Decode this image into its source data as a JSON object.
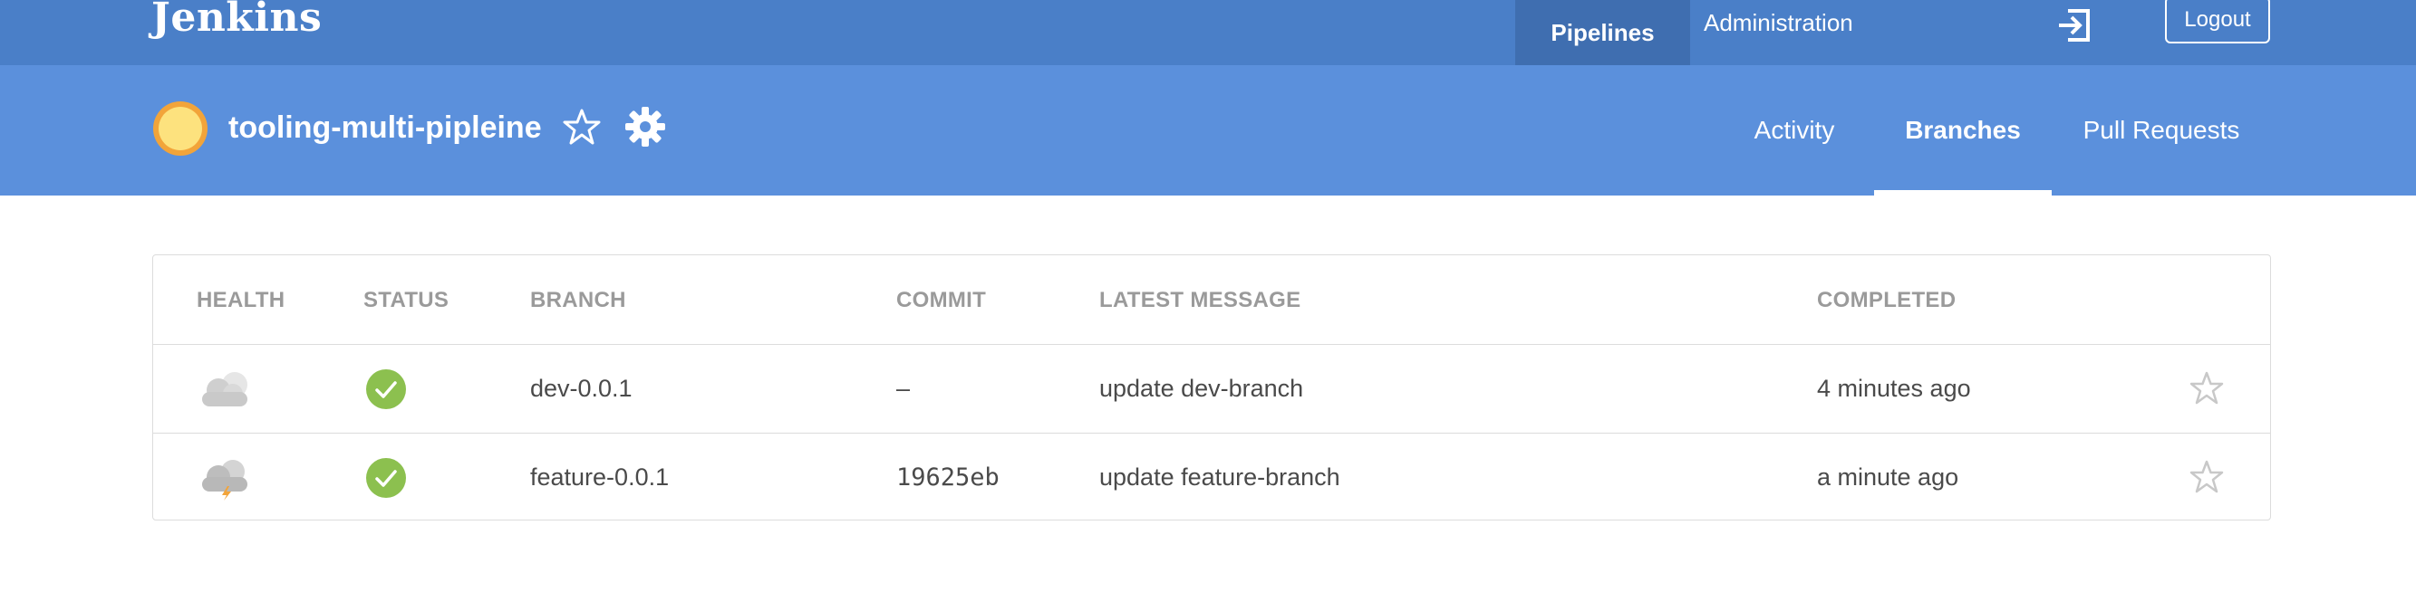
{
  "header": {
    "brand": "Jenkins",
    "nav": {
      "pipelines": "Pipelines",
      "administration": "Administration"
    },
    "logout_label": "Logout",
    "colors": {
      "bar": "#4a7fc8",
      "active_nav": "#3f6eb0"
    }
  },
  "pipeline": {
    "name": "tooling-multi-pipleine",
    "tabs": {
      "activity": "Activity",
      "branches": "Branches",
      "pull_requests": "Pull Requests"
    },
    "active_tab": "Branches",
    "colors": {
      "bar": "#5b90dc"
    }
  },
  "table": {
    "columns": {
      "health": "HEALTH",
      "status": "STATUS",
      "branch": "BRANCH",
      "commit": "COMMIT",
      "message": "LATEST MESSAGE",
      "completed": "COMPLETED"
    },
    "rows": [
      {
        "health_icon": "cloudy-weather-icon",
        "status_icon": "success-check-icon",
        "branch": "dev-0.0.1",
        "commit": "–",
        "message": "update dev-branch",
        "completed": "4 minutes ago"
      },
      {
        "health_icon": "storm-weather-icon",
        "status_icon": "success-check-icon",
        "branch": "feature-0.0.1",
        "commit": "19625eb",
        "message": "update feature-branch",
        "completed": "a minute ago"
      }
    ],
    "colors": {
      "success": "#8cc04f",
      "border": "#dcdcdc"
    }
  }
}
